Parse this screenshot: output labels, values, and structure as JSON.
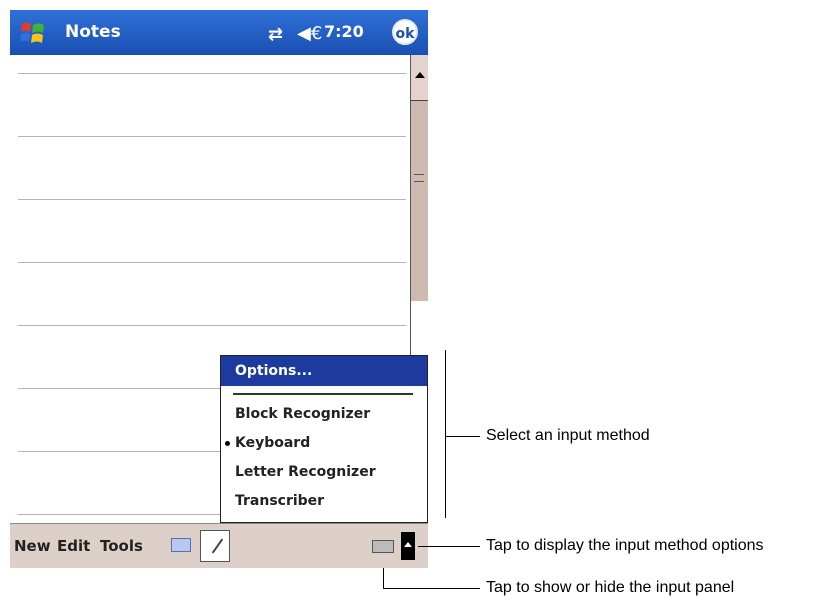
{
  "title_bar": {
    "app_title": "Notes",
    "time": "7:20",
    "ok_label": "ok",
    "start_icon": "windows-flag-icon",
    "connectivity_icon": "connectivity-icon",
    "volume_icon": "speaker-icon"
  },
  "input_menu": {
    "options_label": "Options...",
    "items": [
      "Block Recognizer",
      "Keyboard",
      "Letter Recognizer",
      "Transcriber"
    ],
    "selected": "Keyboard"
  },
  "menu_bar": {
    "new_label": "New",
    "edit_label": "Edit",
    "tools_label": "Tools"
  },
  "callouts": {
    "select_method": "Select an input method",
    "display_options": "Tap to display the input method options",
    "show_hide_panel": "Tap to show or hide the input panel"
  },
  "colors": {
    "titlebar": "#1a50b2",
    "menu_highlight": "#1d3a9e",
    "menubar": "#ddd0c8"
  }
}
